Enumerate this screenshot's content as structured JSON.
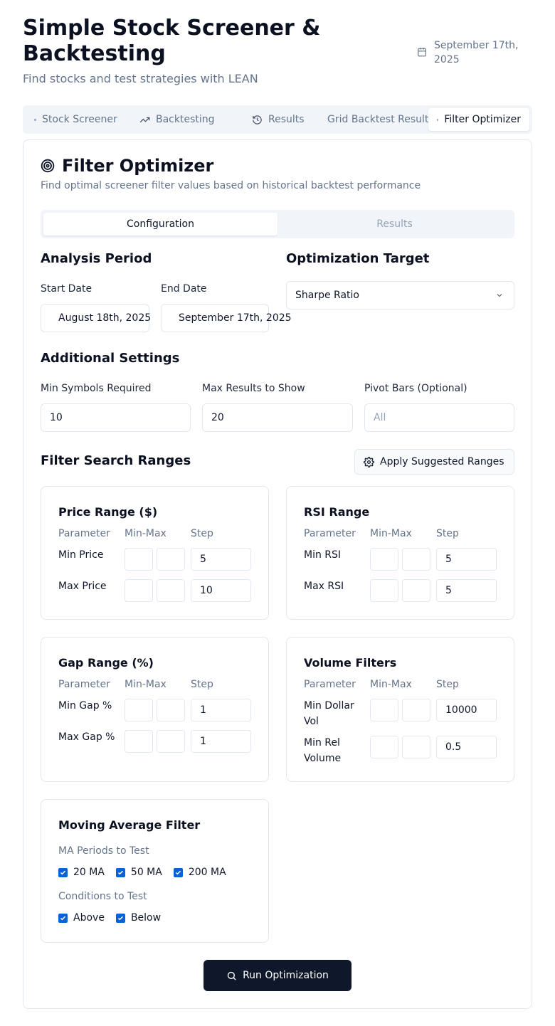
{
  "header": {
    "title": "Simple Stock Screener & Backtesting",
    "subtitle": "Find stocks and test strategies with LEAN",
    "date": "September 17th, 2025"
  },
  "main_tabs": [
    {
      "label": "Stock Screener",
      "icon": "dot-icon"
    },
    {
      "label": "Backtesting",
      "icon": "trending-up-icon"
    },
    {
      "label": "Results",
      "icon": "history-icon"
    },
    {
      "label": "Grid Backtest Results",
      "icon": "none"
    },
    {
      "label": "Filter Optimizer",
      "icon": "dot-icon",
      "active": true
    }
  ],
  "optimizer": {
    "title": "Filter Optimizer",
    "description": "Find optimal screener filter values based on historical backtest performance",
    "sub_tabs": [
      {
        "label": "Configuration",
        "active": true
      },
      {
        "label": "Results",
        "active": false
      }
    ],
    "analysis_period": {
      "title": "Analysis Period",
      "start_label": "Start Date",
      "start_value": "August 18th, 2025",
      "end_label": "End Date",
      "end_value": "September 17th, 2025"
    },
    "optimization_target": {
      "title": "Optimization Target",
      "selected": "Sharpe Ratio"
    },
    "additional_settings": {
      "title": "Additional Settings",
      "min_symbols_label": "Min Symbols Required",
      "min_symbols_value": "10",
      "max_results_label": "Max Results to Show",
      "max_results_value": "20",
      "pivot_bars_label": "Pivot Bars (Optional)",
      "pivot_bars_placeholder": "All"
    },
    "filter_ranges": {
      "title": "Filter Search Ranges",
      "apply_button": "Apply Suggested Ranges",
      "col_parameter": "Parameter",
      "col_minmax": "Min-Max",
      "col_step": "Step",
      "price": {
        "title": "Price Range ($)",
        "rows": [
          {
            "label": "Min Price",
            "step": "5"
          },
          {
            "label": "Max Price",
            "step": "10"
          }
        ]
      },
      "rsi": {
        "title": "RSI Range",
        "rows": [
          {
            "label": "Min RSI",
            "step": "5"
          },
          {
            "label": "Max RSI",
            "step": "5"
          }
        ]
      },
      "gap": {
        "title": "Gap Range (%)",
        "rows": [
          {
            "label": "Min Gap %",
            "step": "1"
          },
          {
            "label": "Max Gap %",
            "step": "1"
          }
        ]
      },
      "volume": {
        "title": "Volume Filters",
        "rows": [
          {
            "label": "Min Dollar Vol",
            "step": "10000"
          },
          {
            "label": "Min Rel Volume",
            "step": "0.5"
          }
        ]
      }
    },
    "moving_average": {
      "title": "Moving Average Filter",
      "periods_label": "MA Periods to Test",
      "periods": [
        {
          "label": "20 MA",
          "checked": true
        },
        {
          "label": "50 MA",
          "checked": true
        },
        {
          "label": "200 MA",
          "checked": true
        }
      ],
      "conditions_label": "Conditions to Test",
      "conditions": [
        {
          "label": "Above",
          "checked": true
        },
        {
          "label": "Below",
          "checked": true
        }
      ]
    },
    "run_button": "Run Optimization"
  }
}
